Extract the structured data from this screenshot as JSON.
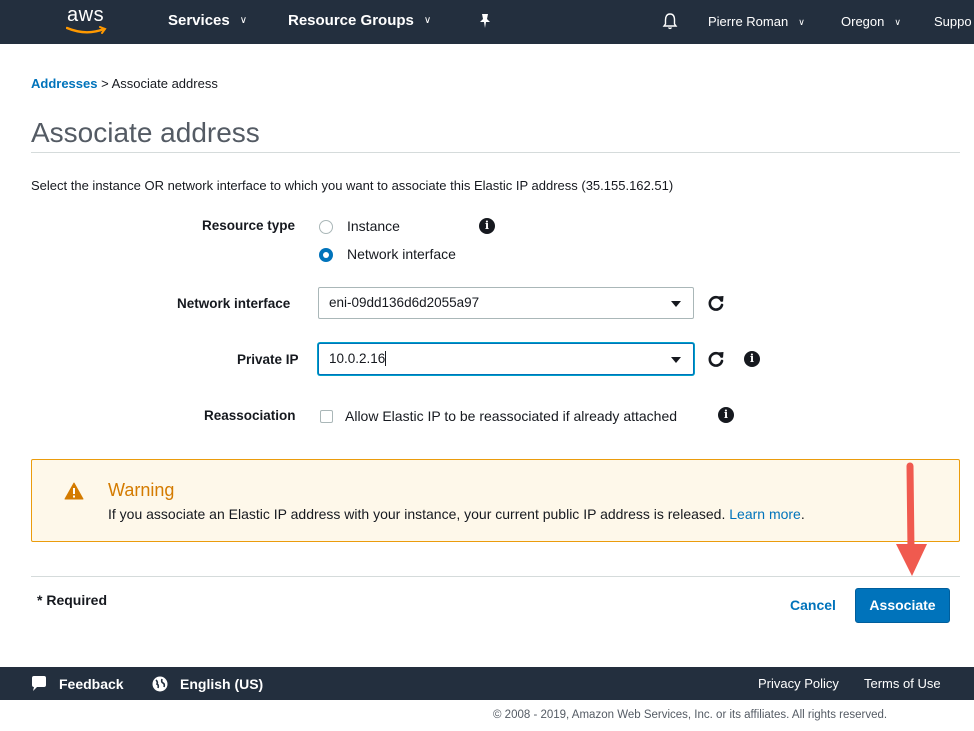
{
  "nav": {
    "logo": "aws",
    "services": "Services",
    "resource_groups": "Resource Groups",
    "user": "Pierre Roman",
    "region": "Oregon",
    "support": "Suppo"
  },
  "breadcrumb": {
    "parent": "Addresses",
    "separator": ">",
    "current": "Associate address"
  },
  "page": {
    "title": "Associate address",
    "instructions": "Select the instance OR network interface to which you want to associate this Elastic IP address (35.155.162.51)"
  },
  "form": {
    "resource_type": {
      "label": "Resource type",
      "options": [
        "Instance",
        "Network interface"
      ],
      "selected": "Network interface"
    },
    "network_interface": {
      "label": "Network interface",
      "value": "eni-09dd136d6d2055a97"
    },
    "private_ip": {
      "label": "Private IP",
      "value": "10.0.2.16"
    },
    "reassociation": {
      "label": "Reassociation",
      "checkbox_label": "Allow Elastic IP to be reassociated if already attached",
      "checked": false
    }
  },
  "warning": {
    "title": "Warning",
    "text": "If you associate an Elastic IP address with your instance, your current public IP address is released.",
    "link": "Learn more",
    "trailing": "."
  },
  "footer": {
    "required": "* Required",
    "cancel": "Cancel",
    "associate": "Associate"
  },
  "bottombar": {
    "feedback": "Feedback",
    "language": "English (US)",
    "privacy": "Privacy Policy",
    "terms": "Terms of Use",
    "copyright": "© 2008 - 2019, Amazon Web Services, Inc. or its affiliates. All rights reserved."
  },
  "colors": {
    "nav_bg": "#232f3e",
    "link": "#0073bb",
    "primary_button": "#0073bb",
    "warning_border": "#eb9c0c",
    "warning_title": "#d47b00",
    "annotation_arrow": "#f05a4f"
  }
}
